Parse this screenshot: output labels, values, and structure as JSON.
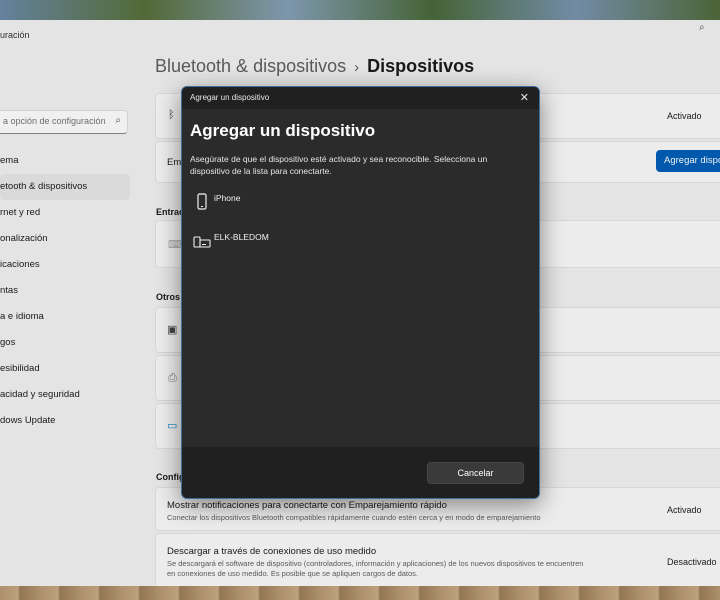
{
  "window": {
    "title": "uración"
  },
  "search": {
    "placeholder": "a opción de configuración"
  },
  "nav": {
    "items": [
      {
        "label": "ema"
      },
      {
        "label": "etooth & dispositivos",
        "active": true
      },
      {
        "label": "rnet y red"
      },
      {
        "label": "onalización"
      },
      {
        "label": "icaciones"
      },
      {
        "label": "ntas"
      },
      {
        "label": "a e idioma"
      },
      {
        "label": "gos"
      },
      {
        "label": "esibilidad"
      },
      {
        "label": "acidad y seguridad"
      },
      {
        "label": "dows Update"
      }
    ]
  },
  "breadcrumb": {
    "parent": "Bluetooth & dispositivos",
    "separator": "›",
    "current": "Dispositivos"
  },
  "bluetooth_row": {
    "status": "Activado",
    "icon": "bluetooth-icon"
  },
  "add_row": {
    "title_partial": "Emp",
    "button": "Agregar dispo"
  },
  "sections": {
    "input": "Entrac",
    "others": "Otros",
    "config": "Config"
  },
  "settings_rows": [
    {
      "title": "Mostrar notificaciones para conectarte con Emparejamiento rápido",
      "desc": "Conectar los dispositivos Bluetooth compatibles rápidamente cuando estén cerca y en modo de emparejamiento",
      "status": "Activado"
    },
    {
      "title": "Descargar a través de conexiones de uso medido",
      "desc_line1": "Se descargará el software de dispositivo (controladores, información y aplicaciones) de los nuevos dispositivos te encuentren",
      "desc_line2": "en conexiones de uso medido. Es posible que se apliquen cargos de datos.",
      "status": "Desactivado"
    }
  ],
  "dialog": {
    "window_title": "Agregar un dispositivo",
    "heading": "Agregar un dispositivo",
    "description": "Asegúrate de que el dispositivo esté activado y sea reconocible. Selecciona un dispositivo de la lista para conectarte.",
    "devices": [
      {
        "name": "iPhone",
        "icon": "phone-icon"
      },
      {
        "name": "ELK-BLEDOM",
        "icon": "generic-device-icon"
      }
    ],
    "cancel": "Cancelar"
  },
  "colors": {
    "accent": "#005fb8",
    "dialog_bg": "#2b2b2b",
    "dialog_border": "#3d6f9f"
  }
}
